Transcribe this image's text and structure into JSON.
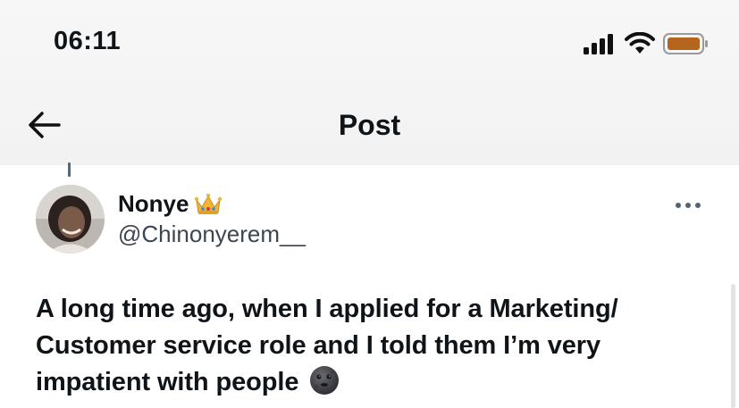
{
  "status_bar": {
    "time": "06:11",
    "signal_icon": "signal-bars-icon",
    "wifi_icon": "wifi-icon",
    "battery_icon": "battery-icon",
    "battery_color": "#b5651d"
  },
  "nav": {
    "back_icon": "arrow-left-icon",
    "title": "Post"
  },
  "post": {
    "author": {
      "display_name": "Nonye",
      "badge_icon": "crown-emoji",
      "handle": "@Chinonyerem__"
    },
    "more_icon": "more-horizontal-icon",
    "text_line1": "A long time ago, when I applied for a Marketing/",
    "text_line2": "Customer service role and I told them I’m very",
    "text_line3": "impatient with people",
    "text_emoji": "new-moon-face-emoji"
  }
}
